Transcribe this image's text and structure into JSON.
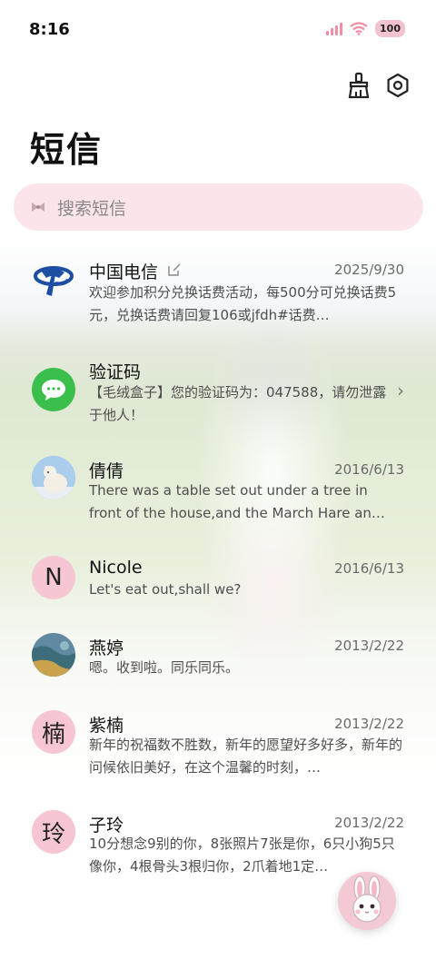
{
  "status_bar": {
    "time": "8:16",
    "battery": "100",
    "accent": "#f08ea4"
  },
  "header": {
    "title": "短信"
  },
  "search": {
    "placeholder": "搜索短信"
  },
  "messages": [
    {
      "name": "中国电信",
      "date": "2025/9/30",
      "snippet": "欢迎参加积分兑换话费活动，每500分可兑换话费5元，兑换话费请回复106或jfdh#话费…",
      "avatar": "telecom-logo"
    },
    {
      "name": "验证码",
      "date": "",
      "snippet": "【毛绒盒子】您的验证码为：047588，请勿泄露于他人！",
      "avatar": "message-icon"
    },
    {
      "name": "倩倩",
      "date": "2016/6/13",
      "snippet": "There was a table set out under a tree in front of the house,and the March Hare an…",
      "avatar": "polar-bear-photo"
    },
    {
      "name": "Nicole",
      "date": "2016/6/13",
      "snippet": "Let's eat out,shall we?",
      "avatar_letter": "N"
    },
    {
      "name": "燕婷",
      "date": "2013/2/22",
      "snippet": "嗯。收到啦。同乐同乐。",
      "avatar": "landscape-photo"
    },
    {
      "name": "紫楠",
      "date": "2013/2/22",
      "snippet": "新年的祝福数不胜数，新年的愿望好多好多，新年的问候依旧美好，在这个温馨的时刻，…",
      "avatar_letter": "楠"
    },
    {
      "name": "子玲",
      "date": "2013/2/22",
      "snippet": "10分想念9别的你，8张照片7张是你，6只小狗5只像你，4根骨头3根归你，2爪着地1定…",
      "avatar_letter": "玲"
    }
  ]
}
